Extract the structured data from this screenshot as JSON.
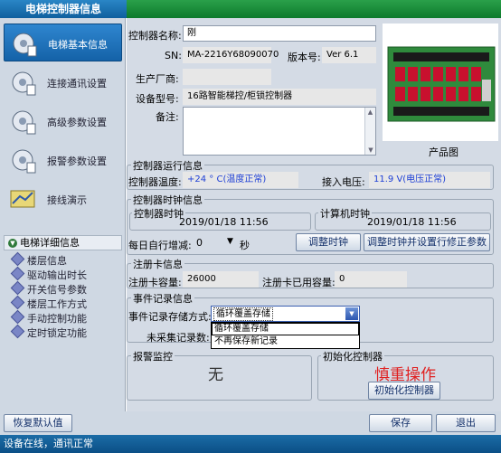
{
  "window": {
    "title": "电梯控制器信息"
  },
  "sidebar": {
    "items": [
      {
        "label": "电梯基本信息",
        "icon": "gear-icon",
        "active": true
      },
      {
        "label": "连接通讯设置",
        "icon": "gear-icon",
        "active": false
      },
      {
        "label": "高级参数设置",
        "icon": "gear-icon",
        "active": false
      },
      {
        "label": "报警参数设置",
        "icon": "gear-icon",
        "active": false
      },
      {
        "label": "接线演示",
        "icon": "wiring-icon",
        "active": false
      }
    ],
    "detail_header": "电梯详细信息",
    "sub_items": [
      "楼层信息",
      "驱动输出时长",
      "开关信号参数",
      "楼层工作方式",
      "手动控制功能",
      "定时锁定功能"
    ]
  },
  "basic": {
    "name_label": "控制器名称:",
    "name_value": "刚",
    "sn_label": "SN:",
    "sn_value": "MA-2216Y68090070",
    "version_label": "版本号:",
    "version_value": "Ver 6.1",
    "vendor_label": "生产厂商:",
    "vendor_value": "",
    "model_label": "设备型号:",
    "model_value": "16路智能梯控/柜锁控制器",
    "remark_label": "备注:",
    "remark_value": "",
    "product_caption": "产品图"
  },
  "runtime": {
    "group_title": "控制器运行信息",
    "temp_label": "控制器温度:",
    "temp_value": "+24 ° C(温度正常)",
    "voltage_label": "接入电压:",
    "voltage_value": "11.9 V(电压正常)"
  },
  "clock": {
    "group_title": "控制器时钟信息",
    "controller_title": "控制器时钟",
    "controller_value": "2019/01/18 11:56",
    "computer_title": "计算机时钟",
    "computer_value": "2019/01/18 11:56",
    "drift_label": "每日自行增减:",
    "drift_value": "0",
    "drift_unit": "秒",
    "adjust_button": "调整时钟",
    "adjust_param_button": "调整时钟并设置行修正参数"
  },
  "card": {
    "group_title": "注册卡信息",
    "capacity_label": "注册卡容量:",
    "capacity_value": "26000",
    "used_label": "注册卡已用容量:",
    "used_value": "0"
  },
  "event": {
    "group_title": "事件记录信息",
    "mode_label": "事件记录存储方式:",
    "mode_value": "循环覆盖存储",
    "options": [
      "循环覆盖存储",
      "不再保存新记录"
    ],
    "uncollected_label": "未采集记录数:"
  },
  "alarm": {
    "group_title": "报警监控",
    "value": "无"
  },
  "init": {
    "group_title": "初始化控制器",
    "warning": "慎重操作",
    "button": "初始化控制器"
  },
  "footer": {
    "restore_button": "恢复默认值",
    "save_button": "保存",
    "exit_button": "退出"
  },
  "status": {
    "text": "设备在线，通讯正常"
  },
  "colors": {
    "title_bar": "#0f5f9e",
    "accent_green": "#1a8c3a",
    "warning_red": "#e02020",
    "value_blue": "#1d3fd6"
  }
}
